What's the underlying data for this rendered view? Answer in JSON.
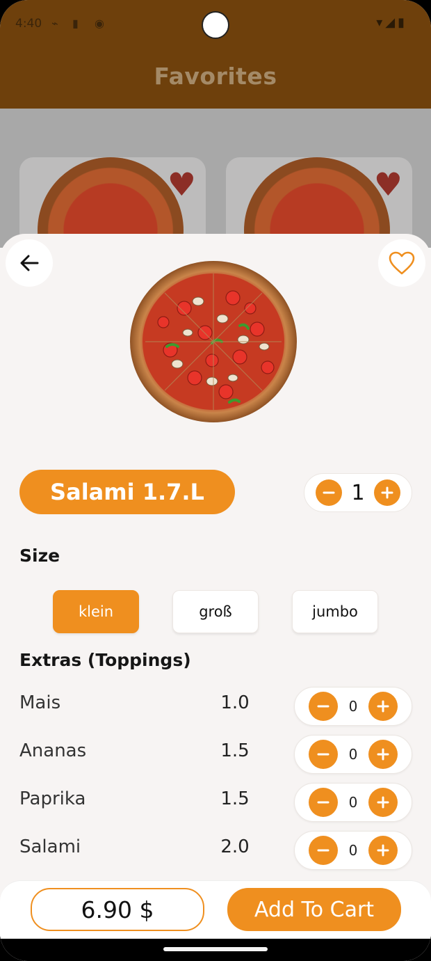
{
  "status_bar": {
    "time": "4:40"
  },
  "header": {
    "title": "Favorites"
  },
  "product": {
    "name": "Salami 1.7.L",
    "quantity": "1"
  },
  "size": {
    "label": "Size",
    "options": [
      "klein",
      "groß",
      "jumbo"
    ],
    "selected": "klein"
  },
  "extras": {
    "label": "Extras (Toppings)",
    "items": [
      {
        "name": "Mais",
        "price": "1.0",
        "qty": "0"
      },
      {
        "name": "Ananas",
        "price": "1.5",
        "qty": "0"
      },
      {
        "name": "Paprika",
        "price": "1.5",
        "qty": "0"
      },
      {
        "name": "Salami",
        "price": "2.0",
        "qty": "0"
      }
    ]
  },
  "footer": {
    "total": "6.90 $",
    "add_to_cart": "Add To Cart"
  },
  "colors": {
    "accent": "#ef8f1f",
    "header_bg": "#6e400c",
    "heart_bg": "#8c2e26"
  },
  "icons": {
    "back": "arrow-left-icon",
    "favorite": "heart-outline-icon",
    "minus": "minus-icon",
    "plus": "plus-icon"
  }
}
